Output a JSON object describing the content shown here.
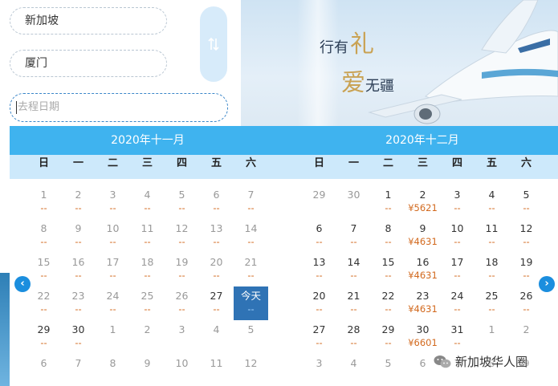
{
  "form": {
    "from_city": "新加坡",
    "to_city": "厦门",
    "date_placeholder": "去程日期"
  },
  "banner": {
    "slogan_line1": "行有",
    "slogan_char1": "礼",
    "slogan_char2": "爱",
    "slogan_line2": "无疆"
  },
  "calendar": {
    "months": [
      {
        "title": "2020年十一月",
        "weekdays": [
          "日",
          "一",
          "二",
          "三",
          "四",
          "五",
          "六"
        ],
        "weeks": [
          [
            {
              "d": "1",
              "p": "--",
              "s": "past"
            },
            {
              "d": "2",
              "p": "--",
              "s": "past"
            },
            {
              "d": "3",
              "p": "--",
              "s": "past"
            },
            {
              "d": "4",
              "p": "--",
              "s": "past"
            },
            {
              "d": "5",
              "p": "--",
              "s": "past"
            },
            {
              "d": "6",
              "p": "--",
              "s": "past"
            },
            {
              "d": "7",
              "p": "--",
              "s": "past"
            }
          ],
          [
            {
              "d": "8",
              "p": "--",
              "s": "past"
            },
            {
              "d": "9",
              "p": "--",
              "s": "past"
            },
            {
              "d": "10",
              "p": "--",
              "s": "past"
            },
            {
              "d": "11",
              "p": "--",
              "s": "past"
            },
            {
              "d": "12",
              "p": "--",
              "s": "past"
            },
            {
              "d": "13",
              "p": "--",
              "s": "past"
            },
            {
              "d": "14",
              "p": "--",
              "s": "past"
            }
          ],
          [
            {
              "d": "15",
              "p": "--",
              "s": "past"
            },
            {
              "d": "16",
              "p": "--",
              "s": "past"
            },
            {
              "d": "17",
              "p": "--",
              "s": "past"
            },
            {
              "d": "18",
              "p": "--",
              "s": "past"
            },
            {
              "d": "19",
              "p": "--",
              "s": "past"
            },
            {
              "d": "20",
              "p": "--",
              "s": "past"
            },
            {
              "d": "21",
              "p": "--",
              "s": "past"
            }
          ],
          [
            {
              "d": "22",
              "p": "--",
              "s": "past"
            },
            {
              "d": "23",
              "p": "--",
              "s": "past"
            },
            {
              "d": "24",
              "p": "--",
              "s": "past"
            },
            {
              "d": "25",
              "p": "--",
              "s": "past"
            },
            {
              "d": "26",
              "p": "--",
              "s": "past"
            },
            {
              "d": "27",
              "p": "--",
              "s": "normal"
            },
            {
              "d": "今天",
              "p": "--",
              "s": "today"
            }
          ],
          [
            {
              "d": "29",
              "p": "--",
              "s": "normal"
            },
            {
              "d": "30",
              "p": "--",
              "s": "normal"
            },
            {
              "d": "1",
              "p": "",
              "s": "other"
            },
            {
              "d": "2",
              "p": "",
              "s": "other"
            },
            {
              "d": "3",
              "p": "",
              "s": "other"
            },
            {
              "d": "4",
              "p": "",
              "s": "other"
            },
            {
              "d": "5",
              "p": "",
              "s": "other"
            }
          ],
          [
            {
              "d": "6",
              "p": "",
              "s": "other"
            },
            {
              "d": "7",
              "p": "",
              "s": "other"
            },
            {
              "d": "8",
              "p": "",
              "s": "other"
            },
            {
              "d": "9",
              "p": "",
              "s": "other"
            },
            {
              "d": "10",
              "p": "",
              "s": "other"
            },
            {
              "d": "11",
              "p": "",
              "s": "other"
            },
            {
              "d": "12",
              "p": "",
              "s": "other"
            }
          ]
        ]
      },
      {
        "title": "2020年十二月",
        "weekdays": [
          "日",
          "一",
          "二",
          "三",
          "四",
          "五",
          "六"
        ],
        "weeks": [
          [
            {
              "d": "29",
              "p": "",
              "s": "other"
            },
            {
              "d": "30",
              "p": "",
              "s": "other"
            },
            {
              "d": "1",
              "p": "--",
              "s": "normal"
            },
            {
              "d": "2",
              "p": "¥5621",
              "s": "normal"
            },
            {
              "d": "3",
              "p": "--",
              "s": "normal"
            },
            {
              "d": "4",
              "p": "--",
              "s": "normal"
            },
            {
              "d": "5",
              "p": "--",
              "s": "normal"
            }
          ],
          [
            {
              "d": "6",
              "p": "--",
              "s": "normal"
            },
            {
              "d": "7",
              "p": "--",
              "s": "normal"
            },
            {
              "d": "8",
              "p": "--",
              "s": "normal"
            },
            {
              "d": "9",
              "p": "¥4631",
              "s": "normal"
            },
            {
              "d": "10",
              "p": "--",
              "s": "normal"
            },
            {
              "d": "11",
              "p": "--",
              "s": "normal"
            },
            {
              "d": "12",
              "p": "--",
              "s": "normal"
            }
          ],
          [
            {
              "d": "13",
              "p": "--",
              "s": "normal"
            },
            {
              "d": "14",
              "p": "--",
              "s": "normal"
            },
            {
              "d": "15",
              "p": "--",
              "s": "normal"
            },
            {
              "d": "16",
              "p": "¥4631",
              "s": "normal"
            },
            {
              "d": "17",
              "p": "--",
              "s": "normal"
            },
            {
              "d": "18",
              "p": "--",
              "s": "normal"
            },
            {
              "d": "19",
              "p": "--",
              "s": "normal"
            }
          ],
          [
            {
              "d": "20",
              "p": "--",
              "s": "normal"
            },
            {
              "d": "21",
              "p": "--",
              "s": "normal"
            },
            {
              "d": "22",
              "p": "--",
              "s": "normal"
            },
            {
              "d": "23",
              "p": "¥4631",
              "s": "normal"
            },
            {
              "d": "24",
              "p": "--",
              "s": "normal"
            },
            {
              "d": "25",
              "p": "--",
              "s": "normal"
            },
            {
              "d": "26",
              "p": "--",
              "s": "normal"
            }
          ],
          [
            {
              "d": "27",
              "p": "--",
              "s": "normal"
            },
            {
              "d": "28",
              "p": "--",
              "s": "normal"
            },
            {
              "d": "29",
              "p": "--",
              "s": "normal"
            },
            {
              "d": "30",
              "p": "¥6601",
              "s": "normal"
            },
            {
              "d": "31",
              "p": "--",
              "s": "normal"
            },
            {
              "d": "1",
              "p": "",
              "s": "other"
            },
            {
              "d": "2",
              "p": "",
              "s": "other"
            }
          ],
          [
            {
              "d": "3",
              "p": "",
              "s": "other"
            },
            {
              "d": "4",
              "p": "",
              "s": "other"
            },
            {
              "d": "5",
              "p": "",
              "s": "other"
            },
            {
              "d": "6",
              "p": "",
              "s": "other"
            },
            {
              "d": "7",
              "p": "",
              "s": "other"
            },
            {
              "d": "8",
              "p": "",
              "s": "other"
            },
            {
              "d": "9",
              "p": "",
              "s": "other"
            }
          ]
        ]
      }
    ]
  },
  "nav": {
    "prev_icon": "chevron-left-icon",
    "next_icon": "chevron-right-icon"
  },
  "watermark": {
    "text": "新加坡华人圈",
    "icon": "wechat-icon"
  },
  "colors": {
    "header_blue": "#3fb3ef",
    "weekday_bg": "#cde9fb",
    "today_bg": "#2f73b5",
    "price_orange": "#d2691e",
    "nav_blue": "#1b8ede"
  }
}
